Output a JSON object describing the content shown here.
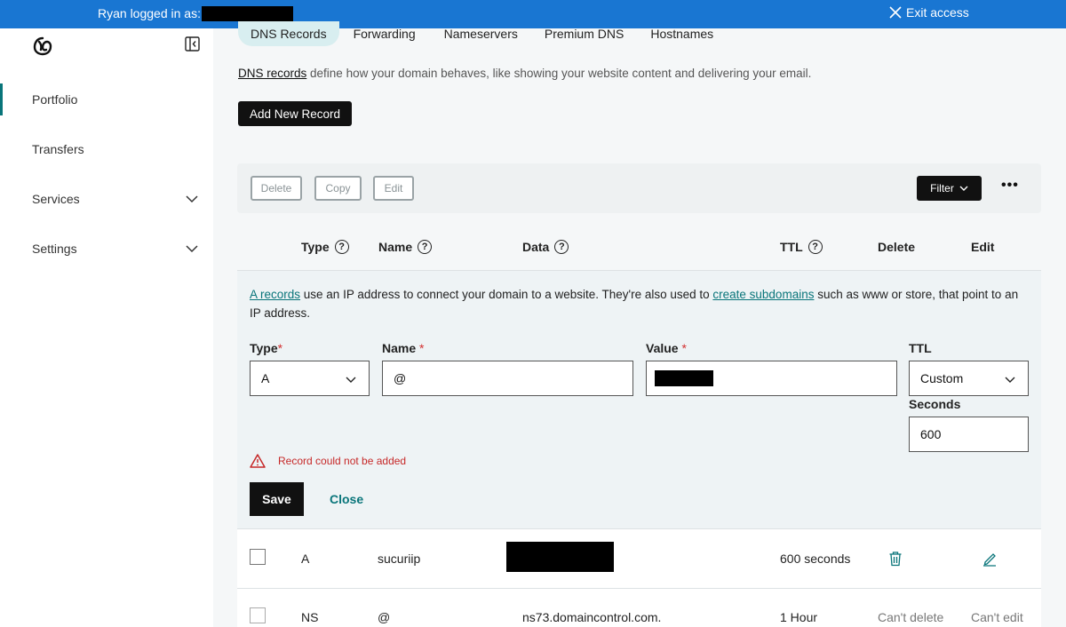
{
  "topbar": {
    "logged_in_label": "Ryan logged in as:",
    "exit_label": "Exit access"
  },
  "sidebar": {
    "items": [
      {
        "label": "Portfolio",
        "active": true,
        "expandable": false
      },
      {
        "label": "Transfers",
        "active": false,
        "expandable": false
      },
      {
        "label": "Services",
        "active": false,
        "expandable": true
      },
      {
        "label": "Settings",
        "active": false,
        "expandable": true
      }
    ]
  },
  "tabs": [
    "DNS Records",
    "Forwarding",
    "Nameservers",
    "Premium DNS",
    "Hostnames"
  ],
  "intro": {
    "link": "DNS records",
    "text": " define how your domain behaves, like showing your website content and delivering your email."
  },
  "add_button": "Add New Record",
  "toolbar": {
    "delete": "Delete",
    "copy": "Copy",
    "edit": "Edit",
    "filter": "Filter"
  },
  "columns": {
    "type": "Type",
    "name": "Name",
    "data": "Data",
    "ttl": "TTL",
    "delete": "Delete",
    "edit": "Edit"
  },
  "form": {
    "intro_link1": "A records",
    "intro_mid": " use an IP address to connect your domain to a website. They're also used to ",
    "intro_link2": "create subdomains",
    "intro_end": " such as www or store, that point to an IP address.",
    "type_label": "Type",
    "type_value": "A",
    "name_label": "Name",
    "name_value": "@",
    "value_label": "Value",
    "ttl_label": "TTL",
    "ttl_value": "Custom",
    "seconds_label": "Seconds",
    "seconds_value": "600",
    "required_mark": "*",
    "error": "Record could not be added",
    "save": "Save",
    "close": "Close"
  },
  "rows": [
    {
      "type": "A",
      "name": "sucuriip",
      "ttl": "600 seconds"
    },
    {
      "type": "NS",
      "name": "@",
      "data": "ns73.domaincontrol.com.",
      "ttl": "1 Hour",
      "delete": "Can't delete",
      "edit": "Can't edit"
    }
  ],
  "colors": {
    "topbar": "#1976d2",
    "accent": "#09757a",
    "error": "#c62828"
  }
}
